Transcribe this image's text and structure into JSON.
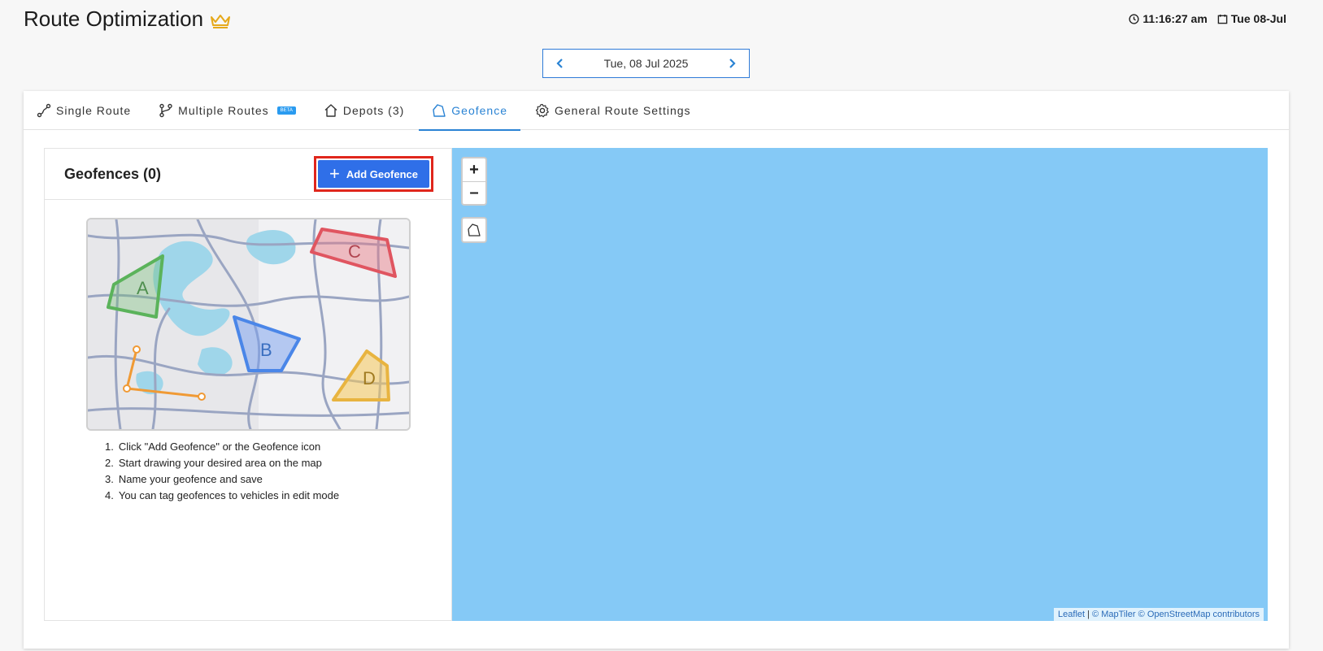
{
  "header": {
    "title": "Route Optimization",
    "crown_icon": "crown-icon",
    "time": "11:16:27 am",
    "date": "Tue 08-Jul"
  },
  "date_nav": {
    "label": "Tue, 08 Jul 2025"
  },
  "tabs": [
    {
      "label": "Single Route",
      "icon": "route-icon"
    },
    {
      "label": "Multiple Routes",
      "icon": "branch-icon",
      "badge": "BETA"
    },
    {
      "label": "Depots (3)",
      "icon": "home-icon"
    },
    {
      "label": "Geofence",
      "icon": "geofence-icon",
      "active": true
    },
    {
      "label": "General Route Settings",
      "icon": "gear-icon"
    }
  ],
  "panel": {
    "title": "Geofences (0)",
    "add_button": "Add Geofence",
    "illustration_labels": [
      "A",
      "B",
      "C",
      "D"
    ],
    "steps": [
      "Click \"Add Geofence\" or the Geofence icon",
      "Start drawing your desired area on the map",
      "Name your geofence and save",
      "You can tag geofences to vehicles in edit mode"
    ],
    "step_numbers": [
      "1.",
      "2.",
      "3.",
      "4."
    ]
  },
  "map": {
    "zoom_in": "+",
    "zoom_out": "–",
    "attribution": {
      "leaflet": "Leaflet",
      "sep": " | ",
      "maptiler": "© MapTiler",
      "osm": "© OpenStreetMap contributors"
    }
  },
  "colors": {
    "accent": "#2a83d4",
    "button": "#2f6fe8",
    "highlight": "#e0261c",
    "map_water": "#85c9f6"
  }
}
